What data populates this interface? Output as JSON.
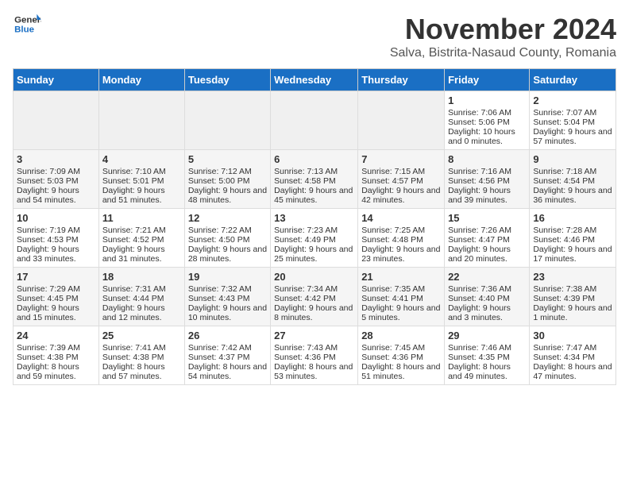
{
  "header": {
    "logo_general": "General",
    "logo_blue": "Blue",
    "month_year": "November 2024",
    "location": "Salva, Bistrita-Nasaud County, Romania"
  },
  "weekdays": [
    "Sunday",
    "Monday",
    "Tuesday",
    "Wednesday",
    "Thursday",
    "Friday",
    "Saturday"
  ],
  "weeks": [
    [
      {
        "day": "",
        "sunrise": "",
        "sunset": "",
        "daylight": ""
      },
      {
        "day": "",
        "sunrise": "",
        "sunset": "",
        "daylight": ""
      },
      {
        "day": "",
        "sunrise": "",
        "sunset": "",
        "daylight": ""
      },
      {
        "day": "",
        "sunrise": "",
        "sunset": "",
        "daylight": ""
      },
      {
        "day": "",
        "sunrise": "",
        "sunset": "",
        "daylight": ""
      },
      {
        "day": "1",
        "sunrise": "Sunrise: 7:06 AM",
        "sunset": "Sunset: 5:06 PM",
        "daylight": "Daylight: 10 hours and 0 minutes."
      },
      {
        "day": "2",
        "sunrise": "Sunrise: 7:07 AM",
        "sunset": "Sunset: 5:04 PM",
        "daylight": "Daylight: 9 hours and 57 minutes."
      }
    ],
    [
      {
        "day": "3",
        "sunrise": "Sunrise: 7:09 AM",
        "sunset": "Sunset: 5:03 PM",
        "daylight": "Daylight: 9 hours and 54 minutes."
      },
      {
        "day": "4",
        "sunrise": "Sunrise: 7:10 AM",
        "sunset": "Sunset: 5:01 PM",
        "daylight": "Daylight: 9 hours and 51 minutes."
      },
      {
        "day": "5",
        "sunrise": "Sunrise: 7:12 AM",
        "sunset": "Sunset: 5:00 PM",
        "daylight": "Daylight: 9 hours and 48 minutes."
      },
      {
        "day": "6",
        "sunrise": "Sunrise: 7:13 AM",
        "sunset": "Sunset: 4:58 PM",
        "daylight": "Daylight: 9 hours and 45 minutes."
      },
      {
        "day": "7",
        "sunrise": "Sunrise: 7:15 AM",
        "sunset": "Sunset: 4:57 PM",
        "daylight": "Daylight: 9 hours and 42 minutes."
      },
      {
        "day": "8",
        "sunrise": "Sunrise: 7:16 AM",
        "sunset": "Sunset: 4:56 PM",
        "daylight": "Daylight: 9 hours and 39 minutes."
      },
      {
        "day": "9",
        "sunrise": "Sunrise: 7:18 AM",
        "sunset": "Sunset: 4:54 PM",
        "daylight": "Daylight: 9 hours and 36 minutes."
      }
    ],
    [
      {
        "day": "10",
        "sunrise": "Sunrise: 7:19 AM",
        "sunset": "Sunset: 4:53 PM",
        "daylight": "Daylight: 9 hours and 33 minutes."
      },
      {
        "day": "11",
        "sunrise": "Sunrise: 7:21 AM",
        "sunset": "Sunset: 4:52 PM",
        "daylight": "Daylight: 9 hours and 31 minutes."
      },
      {
        "day": "12",
        "sunrise": "Sunrise: 7:22 AM",
        "sunset": "Sunset: 4:50 PM",
        "daylight": "Daylight: 9 hours and 28 minutes."
      },
      {
        "day": "13",
        "sunrise": "Sunrise: 7:23 AM",
        "sunset": "Sunset: 4:49 PM",
        "daylight": "Daylight: 9 hours and 25 minutes."
      },
      {
        "day": "14",
        "sunrise": "Sunrise: 7:25 AM",
        "sunset": "Sunset: 4:48 PM",
        "daylight": "Daylight: 9 hours and 23 minutes."
      },
      {
        "day": "15",
        "sunrise": "Sunrise: 7:26 AM",
        "sunset": "Sunset: 4:47 PM",
        "daylight": "Daylight: 9 hours and 20 minutes."
      },
      {
        "day": "16",
        "sunrise": "Sunrise: 7:28 AM",
        "sunset": "Sunset: 4:46 PM",
        "daylight": "Daylight: 9 hours and 17 minutes."
      }
    ],
    [
      {
        "day": "17",
        "sunrise": "Sunrise: 7:29 AM",
        "sunset": "Sunset: 4:45 PM",
        "daylight": "Daylight: 9 hours and 15 minutes."
      },
      {
        "day": "18",
        "sunrise": "Sunrise: 7:31 AM",
        "sunset": "Sunset: 4:44 PM",
        "daylight": "Daylight: 9 hours and 12 minutes."
      },
      {
        "day": "19",
        "sunrise": "Sunrise: 7:32 AM",
        "sunset": "Sunset: 4:43 PM",
        "daylight": "Daylight: 9 hours and 10 minutes."
      },
      {
        "day": "20",
        "sunrise": "Sunrise: 7:34 AM",
        "sunset": "Sunset: 4:42 PM",
        "daylight": "Daylight: 9 hours and 8 minutes."
      },
      {
        "day": "21",
        "sunrise": "Sunrise: 7:35 AM",
        "sunset": "Sunset: 4:41 PM",
        "daylight": "Daylight: 9 hours and 5 minutes."
      },
      {
        "day": "22",
        "sunrise": "Sunrise: 7:36 AM",
        "sunset": "Sunset: 4:40 PM",
        "daylight": "Daylight: 9 hours and 3 minutes."
      },
      {
        "day": "23",
        "sunrise": "Sunrise: 7:38 AM",
        "sunset": "Sunset: 4:39 PM",
        "daylight": "Daylight: 9 hours and 1 minute."
      }
    ],
    [
      {
        "day": "24",
        "sunrise": "Sunrise: 7:39 AM",
        "sunset": "Sunset: 4:38 PM",
        "daylight": "Daylight: 8 hours and 59 minutes."
      },
      {
        "day": "25",
        "sunrise": "Sunrise: 7:41 AM",
        "sunset": "Sunset: 4:38 PM",
        "daylight": "Daylight: 8 hours and 57 minutes."
      },
      {
        "day": "26",
        "sunrise": "Sunrise: 7:42 AM",
        "sunset": "Sunset: 4:37 PM",
        "daylight": "Daylight: 8 hours and 54 minutes."
      },
      {
        "day": "27",
        "sunrise": "Sunrise: 7:43 AM",
        "sunset": "Sunset: 4:36 PM",
        "daylight": "Daylight: 8 hours and 53 minutes."
      },
      {
        "day": "28",
        "sunrise": "Sunrise: 7:45 AM",
        "sunset": "Sunset: 4:36 PM",
        "daylight": "Daylight: 8 hours and 51 minutes."
      },
      {
        "day": "29",
        "sunrise": "Sunrise: 7:46 AM",
        "sunset": "Sunset: 4:35 PM",
        "daylight": "Daylight: 8 hours and 49 minutes."
      },
      {
        "day": "30",
        "sunrise": "Sunrise: 7:47 AM",
        "sunset": "Sunset: 4:34 PM",
        "daylight": "Daylight: 8 hours and 47 minutes."
      }
    ]
  ]
}
